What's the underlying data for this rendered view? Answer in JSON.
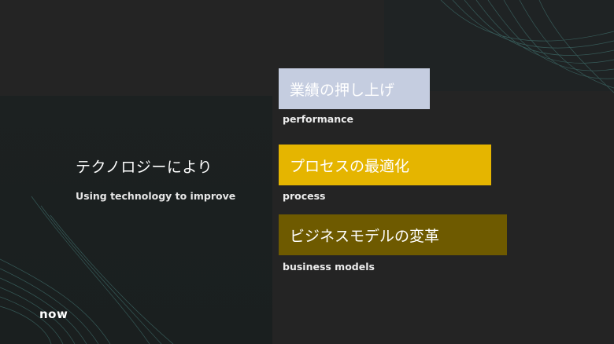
{
  "slide": {
    "subject_jp": "テクノロジーにより",
    "subject_en": "Using technology to improve",
    "items": [
      {
        "label_jp": "業績の押し上げ",
        "caption": "performance",
        "color": "#c5cde0"
      },
      {
        "label_jp": "プロセスの最適化",
        "caption": "process",
        "color": "#e5b500"
      },
      {
        "label_jp": "ビジネスモデルの変革",
        "caption": "business models",
        "color": "#6e5a00"
      }
    ],
    "logo_text": "now"
  },
  "colors": {
    "background": "#242424",
    "panel": "#1c2121",
    "wave_lines": "#3f6e6b"
  }
}
